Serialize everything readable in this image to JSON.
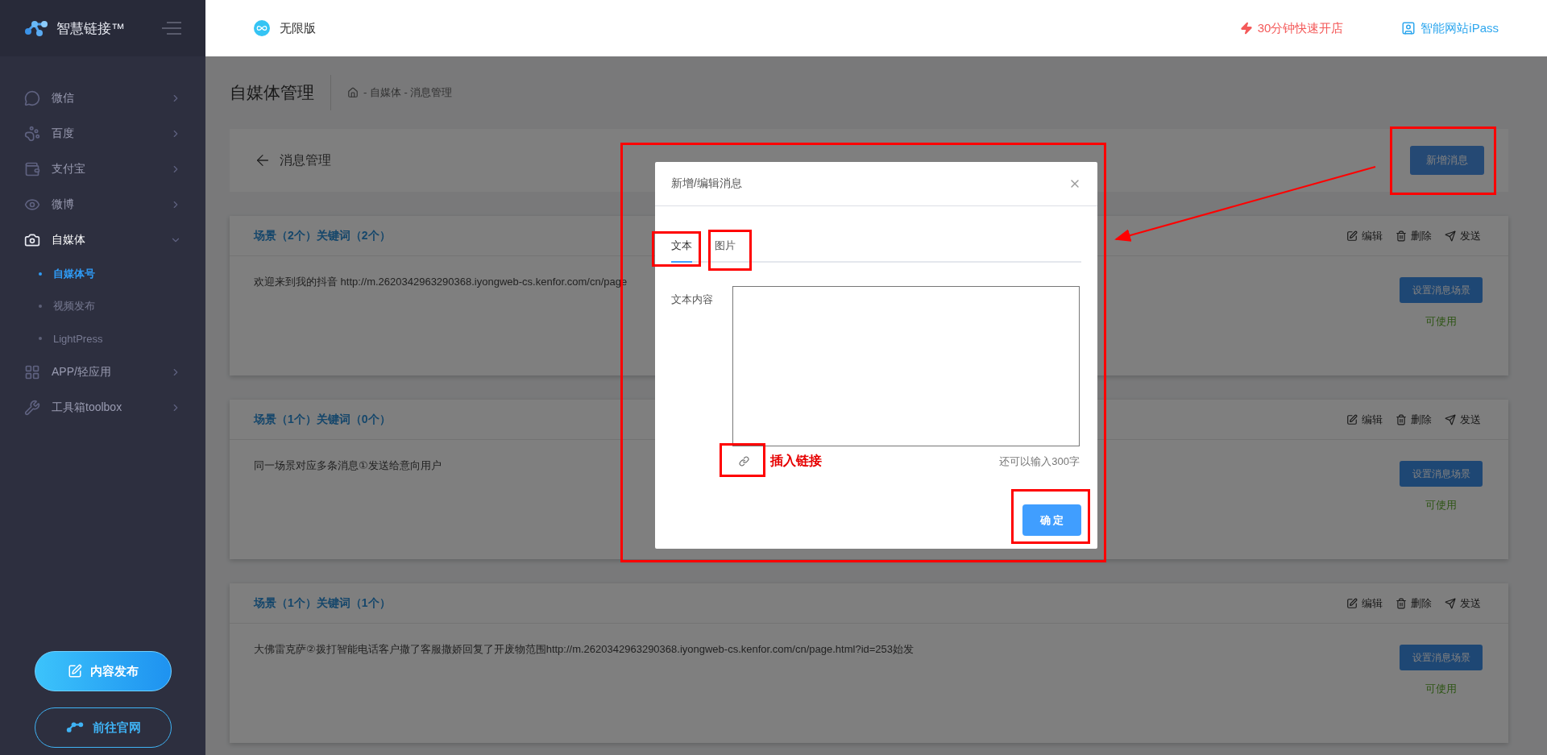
{
  "sidebar": {
    "brand": "智慧链接™",
    "items": [
      {
        "label": "微信",
        "selected": false,
        "expanded": false
      },
      {
        "label": "百度",
        "selected": false,
        "expanded": false
      },
      {
        "label": "支付宝",
        "selected": false,
        "expanded": false
      },
      {
        "label": "微博",
        "selected": false,
        "expanded": false
      },
      {
        "label": "自媒体",
        "selected": true,
        "expanded": true,
        "children": [
          {
            "label": "自媒体号",
            "selected": true
          },
          {
            "label": "视频发布",
            "selected": false
          },
          {
            "label": "LightPress",
            "selected": false
          }
        ]
      },
      {
        "label": "APP/轻应用",
        "selected": false,
        "expanded": false
      },
      {
        "label": "工具箱toolbox",
        "selected": false,
        "expanded": false
      }
    ],
    "buttons": [
      {
        "label": "内容发布",
        "kind": "filled"
      },
      {
        "label": "前往官网",
        "kind": "outline"
      }
    ]
  },
  "header": {
    "edition": "无限版",
    "links": [
      {
        "label": "30分钟快速开店",
        "kind": "promo"
      },
      {
        "label": "智能网站iPass",
        "kind": "site"
      }
    ]
  },
  "page": {
    "title": "自媒体管理",
    "breadcrumb": "- 自媒体 - 消息管理",
    "back_title": "消息管理",
    "add_button": "新增消息"
  },
  "cards": [
    {
      "title": "场景（2个）关键词（2个）",
      "body": "欢迎来到我的抖音 http://m.2620342963290368.iyongweb-cs.kenfor.com/cn/page",
      "actions": [
        "编辑",
        "删除",
        "发送"
      ],
      "set_button": "设置消息场景",
      "status": "可使用"
    },
    {
      "title": "场景（1个）关键词（0个）",
      "body": "同一场景对应多条消息①发送给意向用户",
      "actions": [
        "编辑",
        "删除",
        "发送"
      ],
      "set_button": "设置消息场景",
      "status": "可使用"
    },
    {
      "title": "场景（1个）关键词（1个）",
      "body": "大佛雷克萨②拨打智能电话客户撒了客服撒娇回复了开废物范围http://m.2620342963290368.iyongweb-cs.kenfor.com/cn/page.html?id=253始发",
      "actions": [
        "编辑",
        "删除",
        "发送"
      ],
      "set_button": "设置消息场景",
      "status": "可使用"
    }
  ],
  "dialog": {
    "title": "新增/编辑消息",
    "tabs": [
      {
        "label": "文本",
        "selected": true
      },
      {
        "label": "图片",
        "selected": false
      }
    ],
    "field_label": "文本内容",
    "char_count": "还可以输入300字",
    "confirm": "确 定"
  },
  "annotations": {
    "note": "插入链接"
  }
}
